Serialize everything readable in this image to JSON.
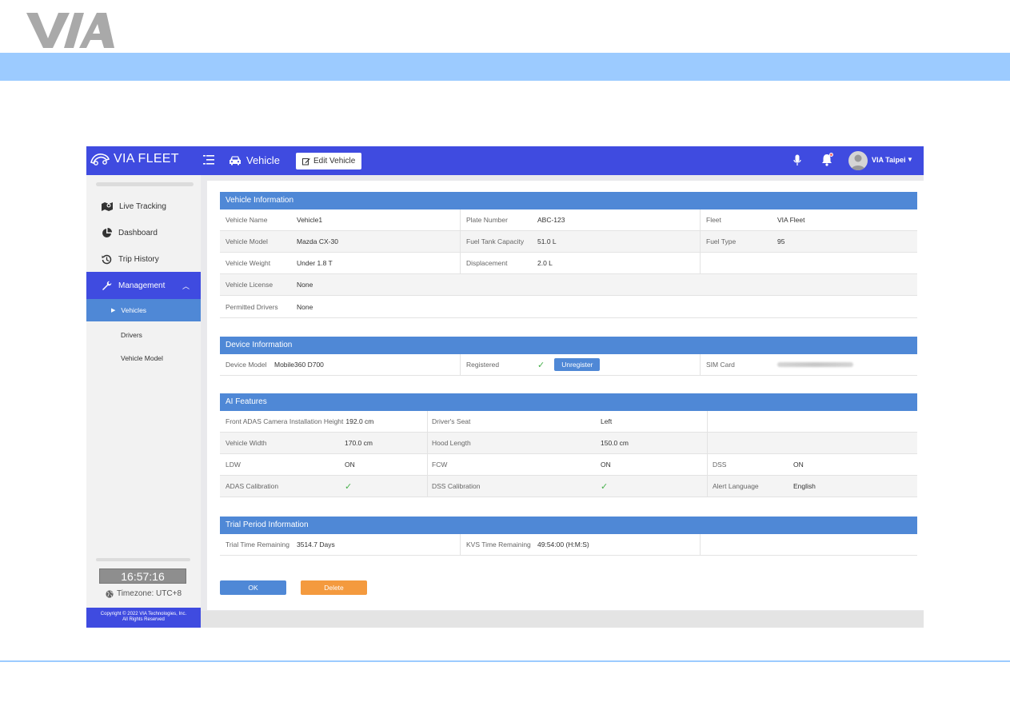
{
  "doc": {
    "logo_text": "VIA"
  },
  "header": {
    "brand": "VIA FLEET",
    "page_title": "Vehicle",
    "edit_button": "Edit Vehicle",
    "user_name": "VIA Taipei",
    "icons": [
      "car-logo-icon",
      "menu-icon",
      "car-icon",
      "edit-icon",
      "microphone-icon",
      "bell-icon",
      "avatar-icon",
      "caret-down-icon"
    ]
  },
  "sidebar": {
    "items": [
      {
        "label": "Live Tracking",
        "icon": "map-pin-icon"
      },
      {
        "label": "Dashboard",
        "icon": "pie-chart-icon"
      },
      {
        "label": "Trip History",
        "icon": "history-icon"
      },
      {
        "label": "Management",
        "icon": "wrench-icon"
      }
    ],
    "subitems": [
      {
        "label": "Vehicles"
      },
      {
        "label": "Drivers"
      },
      {
        "label": "Vehicle Model"
      }
    ],
    "clock": "16:57:16",
    "timezone": "Timezone: UTC+8",
    "copyright_line1": "Copyright © 2022 VIA Technologies, Inc.",
    "copyright_line2": "All Rights Reserved"
  },
  "vehicle_info": {
    "title": "Vehicle Information",
    "vehicle_name_label": "Vehicle Name",
    "vehicle_name": "Vehicle1",
    "plate_label": "Plate Number",
    "plate": "ABC-123",
    "fleet_label": "Fleet",
    "fleet": "VIA Fleet",
    "model_label": "Vehicle Model",
    "model": "Mazda CX-30",
    "tank_label": "Fuel Tank Capacity",
    "tank": "51.0 L",
    "fuel_type_label": "Fuel Type",
    "fuel_type": "95",
    "weight_label": "Vehicle Weight",
    "weight": "Under 1.8 T",
    "displacement_label": "Displacement",
    "displacement": "2.0 L",
    "license_label": "Vehicle License",
    "license": "None",
    "drivers_label": "Permitted Drivers",
    "drivers": "None"
  },
  "device_info": {
    "title": "Device Information",
    "device_model_label": "Device Model",
    "device_model": "Mobile360 D700",
    "registered_label": "Registered",
    "unregister_button": "Unregister",
    "sim_label": "SIM Card"
  },
  "ai_features": {
    "title": "AI Features",
    "adas_height_label": "Front ADAS Camera Installation Height",
    "adas_height": "192.0 cm",
    "seat_label": "Driver's Seat",
    "seat": "Left",
    "width_label": "Vehicle Width",
    "width": "170.0 cm",
    "hood_label": "Hood Length",
    "hood": "150.0 cm",
    "ldw_label": "LDW",
    "ldw": "ON",
    "fcw_label": "FCW",
    "fcw": "ON",
    "dss_label": "DSS",
    "dss": "ON",
    "adas_cal_label": "ADAS Calibration",
    "dss_cal_label": "DSS Calibration",
    "alert_lang_label": "Alert Language",
    "alert_lang": "English"
  },
  "trial_info": {
    "title": "Trial Period Information",
    "trial_label": "Trial Time Remaining",
    "trial": "3514.7 Days",
    "kvs_label": "KVS Time Remaining",
    "kvs": "49:54:00 (H:M:S)"
  },
  "actions": {
    "ok": "OK",
    "delete": "Delete"
  }
}
